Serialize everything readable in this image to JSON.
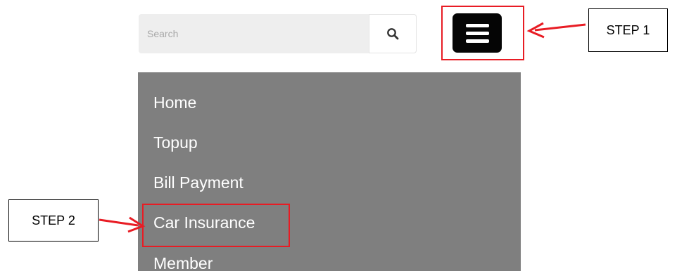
{
  "search": {
    "placeholder": "Search"
  },
  "menu": {
    "items": [
      {
        "label": "Home"
      },
      {
        "label": "Topup"
      },
      {
        "label": "Bill Payment"
      },
      {
        "label": "Car Insurance"
      },
      {
        "label": "Member"
      }
    ]
  },
  "annotations": {
    "step1": "STEP 1",
    "step2": "STEP 2"
  },
  "icons": {
    "search": "search-icon",
    "menu": "hamburger-menu-icon",
    "arrow": "arrow-icon"
  },
  "colors": {
    "menu_background": "#7f7f7f",
    "menu_button": "#050505",
    "annotation": "#e81c24",
    "search_background": "#eeeeee"
  }
}
